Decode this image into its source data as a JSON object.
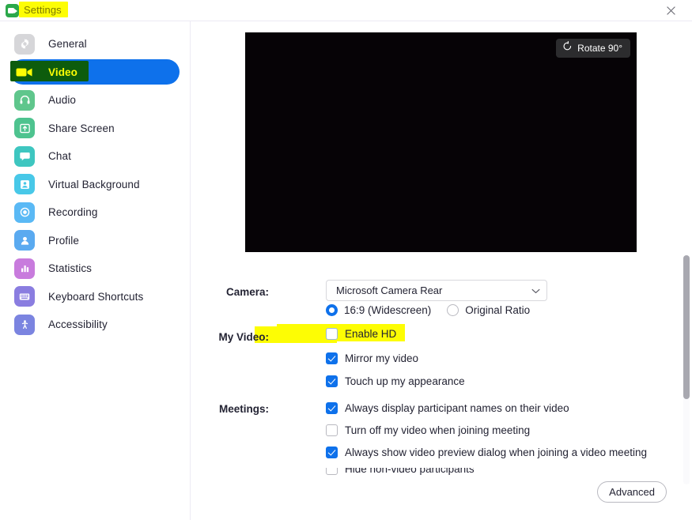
{
  "window": {
    "title": "Settings",
    "logo_icon": "zoom-video-logo-icon",
    "close_icon": "close-icon"
  },
  "sidebar": {
    "items": [
      {
        "label": "General",
        "icon": "gear-icon",
        "active": false
      },
      {
        "label": "Video",
        "icon": "video-camera-icon",
        "active": true
      },
      {
        "label": "Audio",
        "icon": "headphones-icon",
        "active": false
      },
      {
        "label": "Share Screen",
        "icon": "share-screen-icon",
        "active": false
      },
      {
        "label": "Chat",
        "icon": "chat-bubble-icon",
        "active": false
      },
      {
        "label": "Virtual Background",
        "icon": "person-frame-icon",
        "active": false
      },
      {
        "label": "Recording",
        "icon": "record-circle-icon",
        "active": false
      },
      {
        "label": "Profile",
        "icon": "person-icon",
        "active": false
      },
      {
        "label": "Statistics",
        "icon": "bar-chart-icon",
        "active": false
      },
      {
        "label": "Keyboard Shortcuts",
        "icon": "keyboard-icon",
        "active": false
      },
      {
        "label": "Accessibility",
        "icon": "accessibility-icon",
        "active": false
      }
    ]
  },
  "preview": {
    "rotate_label": "Rotate 90°",
    "rotate_icon": "rotate-counterclockwise-icon"
  },
  "camera": {
    "label": "Camera:",
    "selected": "Microsoft Camera Rear",
    "dropdown_icon": "chevron-down-icon",
    "ratio_options": [
      {
        "label": "16:9 (Widescreen)",
        "selected": true
      },
      {
        "label": "Original Ratio",
        "selected": false
      }
    ]
  },
  "my_video": {
    "label": "My Video:",
    "options": [
      {
        "label": "Enable HD",
        "checked": false
      },
      {
        "label": "Mirror my video",
        "checked": true
      },
      {
        "label": "Touch up my appearance",
        "checked": true
      }
    ]
  },
  "meetings": {
    "label": "Meetings:",
    "options": [
      {
        "label": "Always display participant names on their video",
        "checked": true
      },
      {
        "label": "Turn off my video when joining meeting",
        "checked": false
      },
      {
        "label": "Always show video preview dialog when joining a video meeting",
        "checked": true
      },
      {
        "label": "Hide non-video participants",
        "checked": false
      }
    ]
  },
  "footer": {
    "advanced_label": "Advanced"
  },
  "annotations": {
    "highlight_color": "#fdfd04",
    "video_marker_color": "#0d5c0d"
  }
}
